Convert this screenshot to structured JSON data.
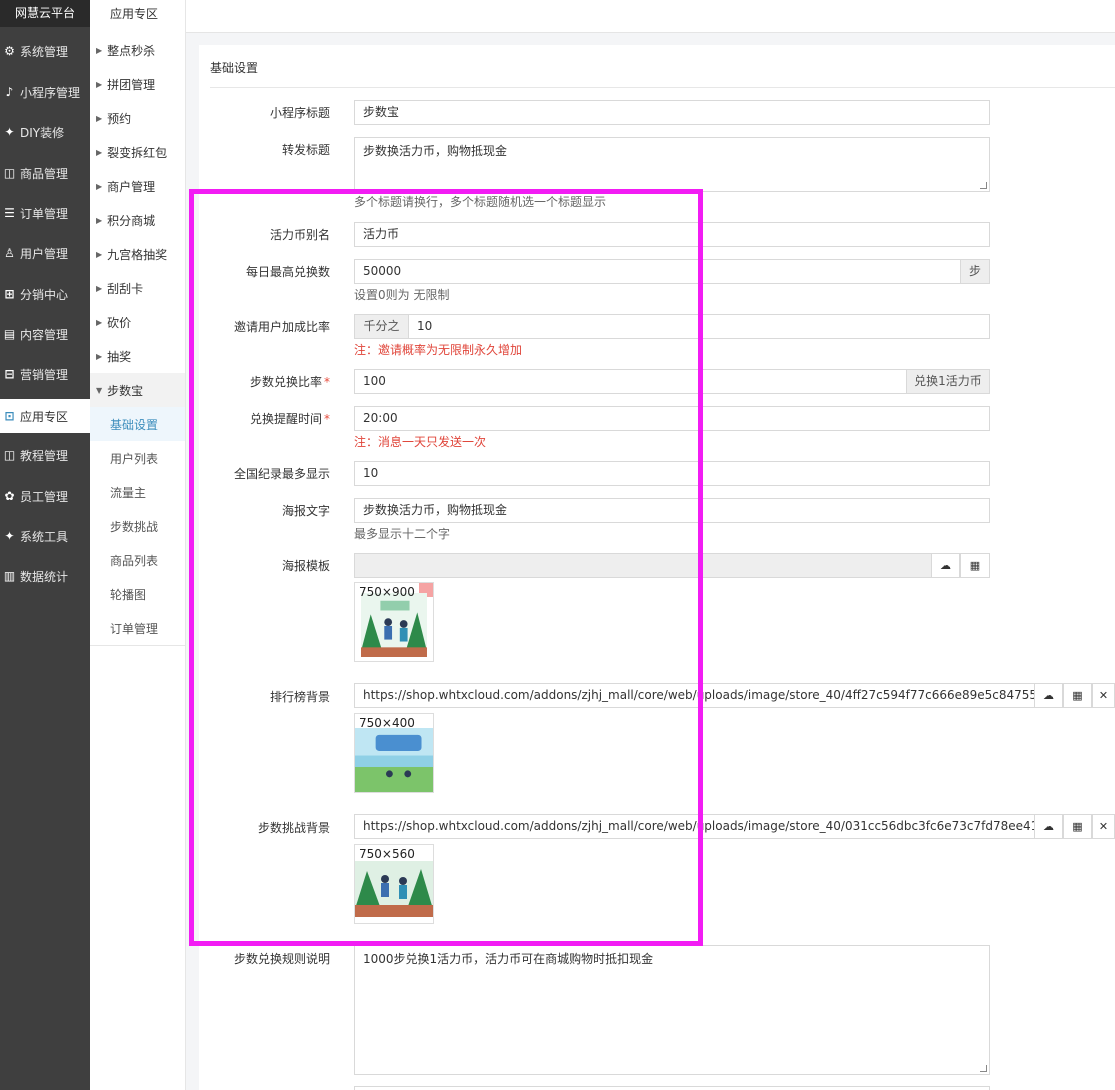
{
  "brand": "网慧云平台",
  "main_nav": [
    {
      "label": "系统管理",
      "icon": "gear-icon",
      "glyph": "⚙"
    },
    {
      "label": "小程序管理",
      "icon": "miniprogram-icon",
      "glyph": "♪"
    },
    {
      "label": "DIY装修",
      "icon": "diy-icon",
      "glyph": "✦"
    },
    {
      "label": "商品管理",
      "icon": "goods-icon",
      "glyph": "◫"
    },
    {
      "label": "订单管理",
      "icon": "order-icon",
      "glyph": "☰"
    },
    {
      "label": "用户管理",
      "icon": "user-icon",
      "glyph": "♙"
    },
    {
      "label": "分销中心",
      "icon": "distribution-icon",
      "glyph": "⊞"
    },
    {
      "label": "内容管理",
      "icon": "content-icon",
      "glyph": "▤"
    },
    {
      "label": "营销管理",
      "icon": "marketing-icon",
      "glyph": "⊟"
    },
    {
      "label": "应用专区",
      "icon": "app-icon",
      "glyph": "⊡",
      "active": true
    },
    {
      "label": "教程管理",
      "icon": "book-icon",
      "glyph": "◫"
    },
    {
      "label": "员工管理",
      "icon": "staff-icon",
      "glyph": "✿"
    },
    {
      "label": "系统工具",
      "icon": "tools-icon",
      "glyph": "✦"
    },
    {
      "label": "数据统计",
      "icon": "stats-icon",
      "glyph": "▥"
    }
  ],
  "sub_nav": {
    "title": "应用专区",
    "items": [
      "整点秒杀",
      "拼团管理",
      "预约",
      "裂变拆红包",
      "商户管理",
      "积分商城",
      "九宫格抽奖",
      "刮刮卡",
      "砍价",
      "抽奖"
    ],
    "open_group": "步数宝",
    "leaves": [
      "基础设置",
      "用户列表",
      "流量主",
      "步数挑战",
      "商品列表",
      "轮播图",
      "订单管理"
    ]
  },
  "panel_title": "基础设置",
  "form": {
    "mini_title": {
      "label": "小程序标题",
      "value": "步数宝"
    },
    "share_title": {
      "label": "转发标题",
      "value": "步数换活力币，购物抵现金",
      "help": "多个标题请换行，多个标题随机选一个标题显示"
    },
    "coin_alias": {
      "label": "活力币别名",
      "value": "活力币"
    },
    "daily_max": {
      "label": "每日最高兑换数",
      "value": "50000",
      "suffix": "步",
      "help": "设置0则为 无限制"
    },
    "invite_rate": {
      "label": "邀请用户加成比率",
      "prefix": "千分之",
      "value": "10",
      "help": "注：邀请概率为无限制永久增加"
    },
    "exchange_rate": {
      "label": "步数兑换比率",
      "value": "100",
      "suffix": "兑换1活力币"
    },
    "remind_time": {
      "label": "兑换提醒时间",
      "value": "20:00",
      "help": "注：消息一天只发送一次"
    },
    "national_max": {
      "label": "全国纪录最多显示",
      "value": "10"
    },
    "poster_text": {
      "label": "海报文字",
      "value": "步数换活力币，购物抵现金",
      "help": "最多显示十二个字"
    },
    "poster_template": {
      "label": "海报模板",
      "value": "",
      "thumb_size": "750×900"
    },
    "rank_bg": {
      "label": "排行榜背景",
      "value": "https://shop.whtxcloud.com/addons/zjhj_mall/core/web/uploads/image/store_40/4ff27c594f77c666e89e5c8475507462c8434675.png",
      "thumb_size": "750×400"
    },
    "challenge_bg": {
      "label": "步数挑战背景",
      "value": "https://shop.whtxcloud.com/addons/zjhj_mall/core/web/uploads/image/store_40/031cc56dbc3fc6e73c7fd78ee41b6820aef42e9a.png",
      "thumb_size": "750×560"
    },
    "rules": {
      "label": "步数兑换规则说明",
      "value": "1000步兑换1活力币，活力币可在商城购物时抵扣现金"
    }
  },
  "icons": {
    "upload": "upload-cloud-icon",
    "picker": "grid-picker-icon",
    "clear": "clear-icon"
  },
  "colors": {
    "highlight": "#f21cf4",
    "required": "#e74c3c",
    "warning_text": "#e0453a",
    "active_link": "#3c8dbc"
  }
}
